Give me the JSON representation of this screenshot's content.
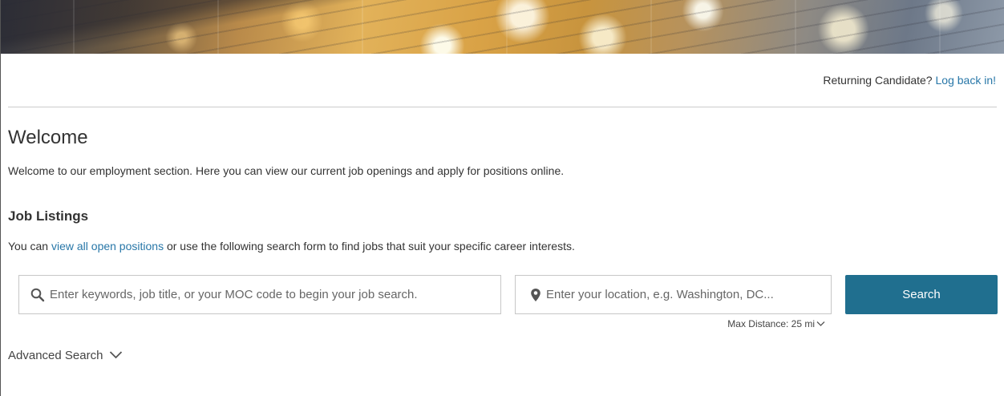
{
  "header": {
    "returning_text": "Returning Candidate?",
    "login_link": "Log back in!"
  },
  "welcome": {
    "title": "Welcome",
    "text": "Welcome to our employment section. Here you can view our current job openings and apply for positions online."
  },
  "job_listings": {
    "title": "Job Listings",
    "text_before": "You can ",
    "link": "view all open positions",
    "text_after": " or use the following search form to find jobs that suit your specific career interests."
  },
  "search": {
    "keywords_placeholder": "Enter keywords, job title, or your MOC code to begin your job search.",
    "keywords_value": "",
    "location_placeholder": "Enter your location, e.g. Washington, DC...",
    "location_value": "",
    "button_label": "Search",
    "max_distance_label": "Max Distance: 25 mi",
    "advanced_label": "Advanced Search"
  },
  "icons": {
    "keywords_icon": "search-icon",
    "location_icon": "map-pin-icon",
    "distance_toggle": "chevron-down-icon",
    "advanced_toggle": "chevron-down-icon"
  },
  "colors": {
    "link": "#2877a8",
    "button": "#206f8f",
    "text": "#333333"
  }
}
